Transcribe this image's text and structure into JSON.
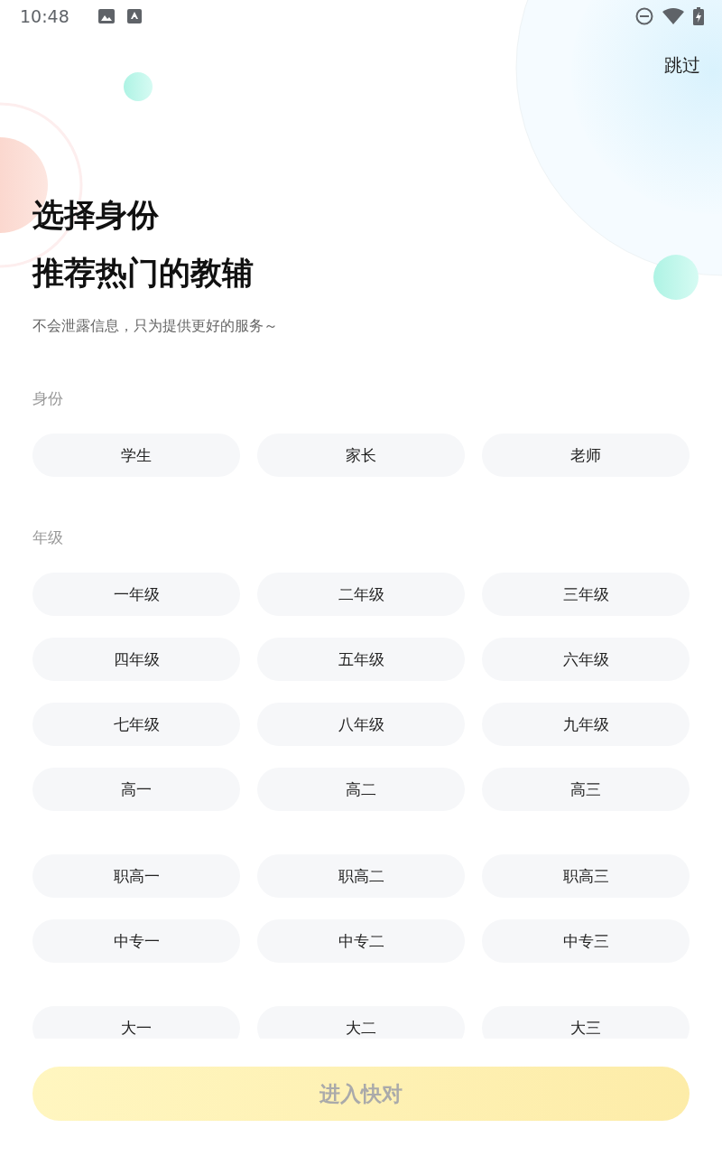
{
  "status_bar": {
    "time": "10:48"
  },
  "skip": "跳过",
  "title_lines": [
    "选择身份",
    "推荐热门的教辅"
  ],
  "subtitle": "不会泄露信息，只为提供更好的服务～",
  "sections": [
    {
      "label": "身份",
      "groups": [
        [
          {
            "label": "学生",
            "selected": false
          },
          {
            "label": "家长",
            "selected": false
          },
          {
            "label": "老师",
            "selected": false
          }
        ]
      ]
    },
    {
      "label": "年级",
      "groups": [
        [
          {
            "label": "一年级",
            "selected": false
          },
          {
            "label": "二年级",
            "selected": false
          },
          {
            "label": "三年级",
            "selected": false
          },
          {
            "label": "四年级",
            "selected": false
          },
          {
            "label": "五年级",
            "selected": false
          },
          {
            "label": "六年级",
            "selected": false
          },
          {
            "label": "七年级",
            "selected": false
          },
          {
            "label": "八年级",
            "selected": false
          },
          {
            "label": "九年级",
            "selected": false
          },
          {
            "label": "高一",
            "selected": false
          },
          {
            "label": "高二",
            "selected": false
          },
          {
            "label": "高三",
            "selected": false
          }
        ],
        [
          {
            "label": "职高一",
            "selected": false
          },
          {
            "label": "职高二",
            "selected": false
          },
          {
            "label": "职高三",
            "selected": false
          },
          {
            "label": "中专一",
            "selected": false
          },
          {
            "label": "中专二",
            "selected": false
          },
          {
            "label": "中专三",
            "selected": false
          }
        ],
        [
          {
            "label": "大一",
            "selected": false
          },
          {
            "label": "大二",
            "selected": false
          },
          {
            "label": "大三",
            "selected": false
          }
        ]
      ]
    }
  ],
  "enter_button": {
    "label": "进入快对",
    "disabled": true
  }
}
